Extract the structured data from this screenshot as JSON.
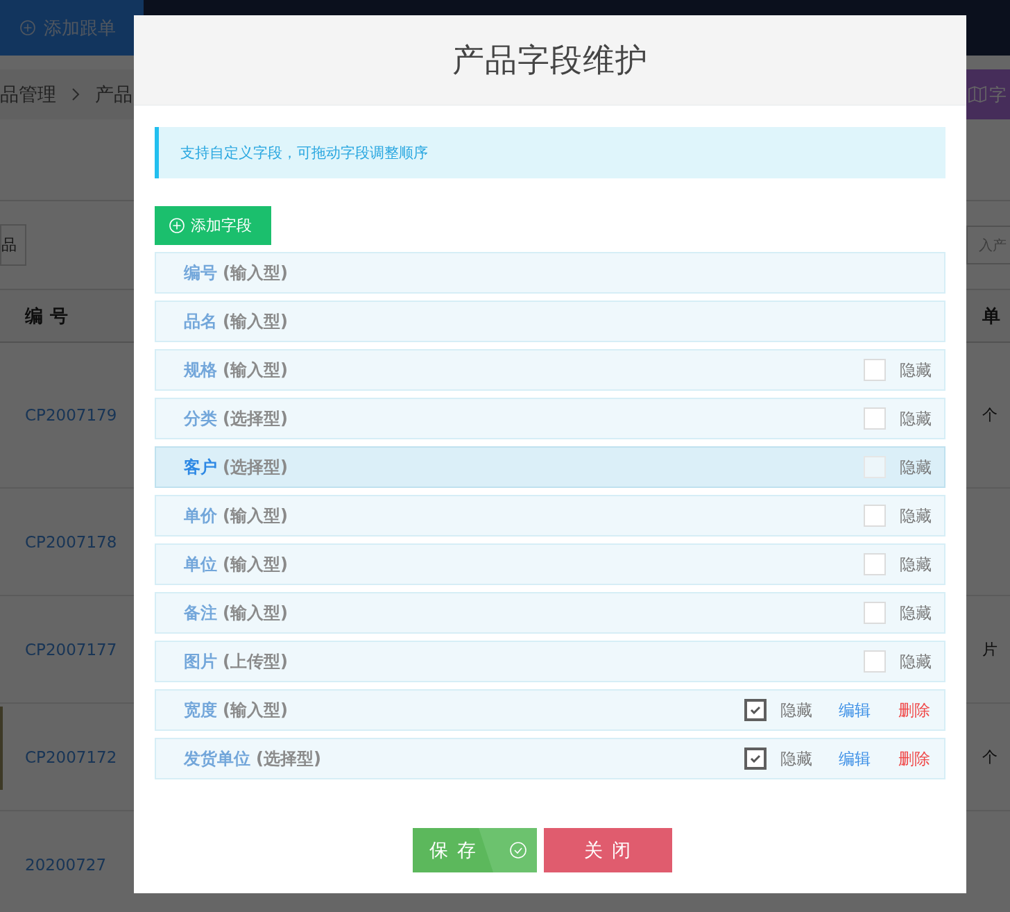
{
  "background_page": {
    "top_bar": {
      "add_button": "添加跟单"
    },
    "breadcrumb": [
      "品管理",
      "产品"
    ],
    "right_button": "字",
    "filter_button": "品",
    "search": {
      "placeholder": "入产"
    },
    "table": {
      "columns": [
        "编号",
        "单"
      ],
      "rows": [
        {
          "column_1": "CP2007179",
          "column_2": "个",
          "photo": false
        },
        {
          "column_1": "CP2007178",
          "photo": false
        },
        {
          "column_1": "CP2007177",
          "column_2": "片",
          "photo": false
        },
        {
          "column_1": "CP2007172",
          "column_2": "个",
          "photo": true
        },
        {
          "column_1": "20200727",
          "photo": false
        }
      ]
    }
  },
  "dialog": {
    "title": "产品字段维护",
    "tip": "支持自定义字段，可拖动字段调整顺序",
    "add_button": "添加字段",
    "fields": [
      {
        "kind": "fixed",
        "name": "编号",
        "type": "(输入型)",
        "selected": false
      },
      {
        "kind": "fixed",
        "name": "品名",
        "type": "(输入型)",
        "selected": false
      },
      {
        "kind": "builtin",
        "name": "规格",
        "type": "(输入型)",
        "selected": false,
        "checked": false,
        "hide_label": "隐藏"
      },
      {
        "kind": "builtin",
        "name": "分类",
        "type": "(选择型)",
        "selected": false,
        "checked": false,
        "hide_label": "隐藏"
      },
      {
        "kind": "builtin",
        "name": "客户",
        "type": "(选择型)",
        "selected": true,
        "checked": false,
        "hide_label": "隐藏"
      },
      {
        "kind": "builtin",
        "name": "单价",
        "type": "(输入型)",
        "selected": false,
        "checked": false,
        "hide_label": "隐藏"
      },
      {
        "kind": "builtin",
        "name": "单位",
        "type": "(输入型)",
        "selected": false,
        "checked": false,
        "hide_label": "隐藏"
      },
      {
        "kind": "builtin",
        "name": "备注",
        "type": "(输入型)",
        "selected": false,
        "checked": false,
        "hide_label": "隐藏"
      },
      {
        "kind": "builtin",
        "name": "图片",
        "type": "(上传型)",
        "selected": false,
        "checked": false,
        "hide_label": "隐藏"
      },
      {
        "kind": "custom",
        "name": "宽度",
        "type": "(输入型)",
        "selected": false,
        "checked": true,
        "hide_label": "隐藏",
        "edit_label": "编辑",
        "delete_label": "删除"
      },
      {
        "kind": "custom",
        "name": "发货单位",
        "type": "(选择型)",
        "selected": false,
        "checked": true,
        "hide_label": "隐藏",
        "edit_label": "编辑",
        "delete_label": "删除"
      }
    ],
    "buttons": [
      {
        "kind": "save",
        "label": "保 存"
      },
      {
        "kind": "close",
        "label": "关 闭"
      }
    ]
  }
}
